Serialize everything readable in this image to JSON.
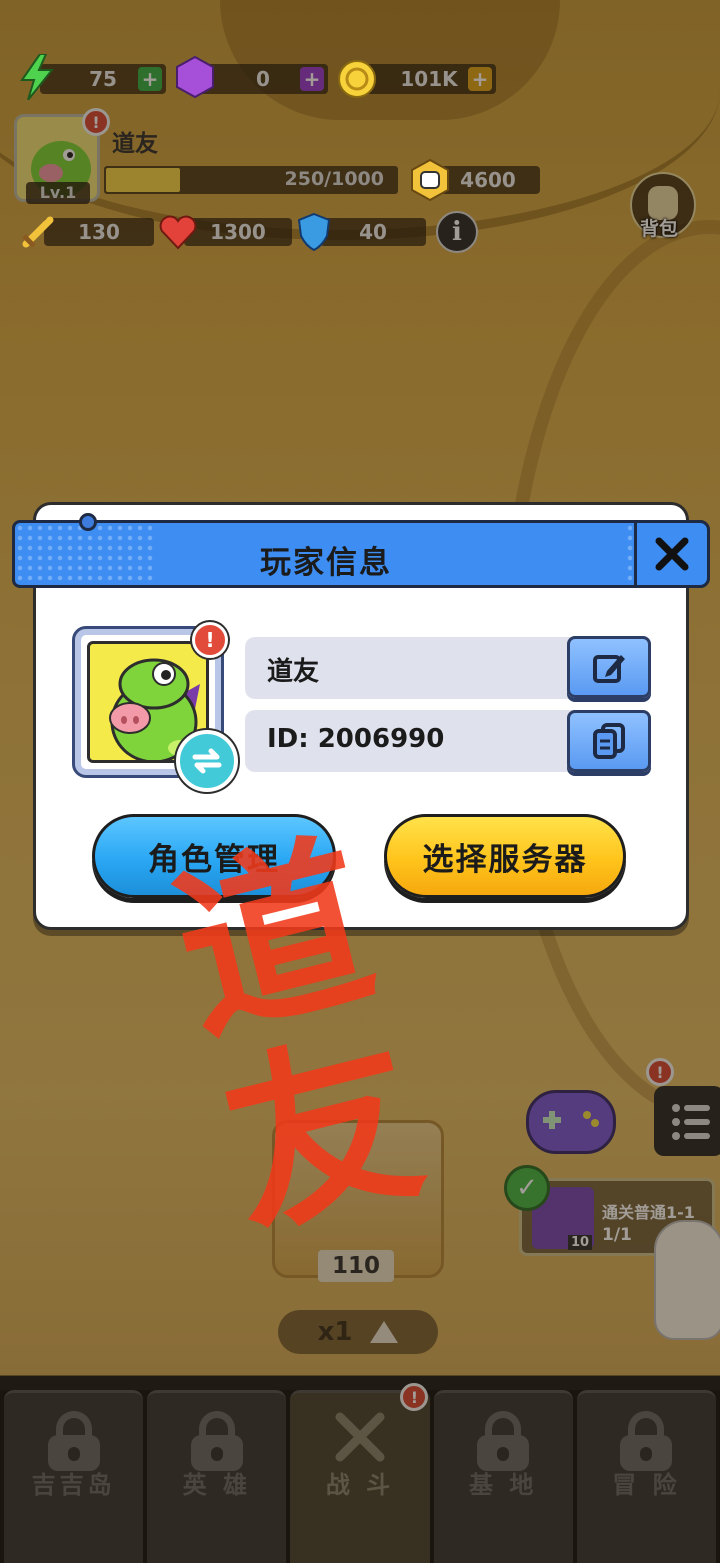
{
  "hud": {
    "energy": "75",
    "gems": "0",
    "coins": "101K",
    "player_name": "道友",
    "level": "Lv.1",
    "xp": "250/1000",
    "xp_fraction": 0.25,
    "power": "4600",
    "attack": "130",
    "health": "1300",
    "defense": "40",
    "bag_label": "背包"
  },
  "modal": {
    "title": "玩家信息",
    "name_value": "道友",
    "id_value": "ID: 2006990",
    "role_button": "角色管理",
    "server_button": "选择服务器"
  },
  "watermark": "道友",
  "quest": {
    "title": "通关普通1-1",
    "progress": "1/1",
    "reward_count": "10"
  },
  "chest": {
    "count": "110",
    "speed": "x1"
  },
  "nav": {
    "items": [
      {
        "label": "吉吉岛"
      },
      {
        "label": "英 雄"
      },
      {
        "label": "战 斗"
      },
      {
        "label": "基 地"
      },
      {
        "label": "冒 险"
      }
    ]
  },
  "colors": {
    "accent_blue": "#3d8df2",
    "button_blue": "#2aa7f4",
    "button_yellow": "#ffc41c",
    "watermark_red": "#f23a1a"
  }
}
